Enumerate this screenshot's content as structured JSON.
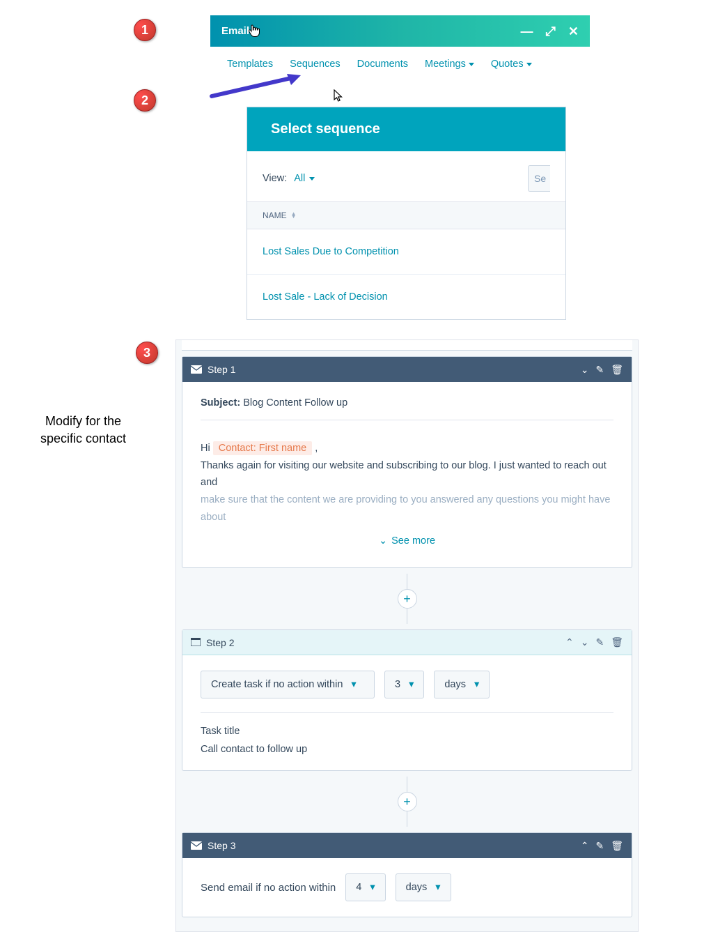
{
  "badges": {
    "b1": "1",
    "b2": "2",
    "b3": "3"
  },
  "emailBar": {
    "title": "Email"
  },
  "tabs": {
    "templates": "Templates",
    "sequences": "Sequences",
    "documents": "Documents",
    "meetings": "Meetings",
    "quotes": "Quotes"
  },
  "seqPanel": {
    "heading": "Select sequence",
    "viewLabel": "View:",
    "viewValue": "All",
    "searchPrefix": "Se",
    "col_name": "NAME",
    "rows": [
      "Lost Sales Due to Competition",
      "Lost Sale - Lack of Decision"
    ]
  },
  "annotation": "Modify for the\nspecific contact",
  "step1": {
    "label": "Step 1",
    "subjectLabel": "Subject:",
    "subjectValue": "Blog Content Follow up",
    "greeting": "Hi ",
    "token": "Contact: First name",
    "comma": " ,",
    "line1": "Thanks again for visiting our website and subscribing to our blog.  I just wanted to reach out and",
    "line2": "make sure that the content we are providing to you answered any questions you might have about",
    "seeMore": "See more"
  },
  "step2": {
    "label": "Step 2",
    "action": "Create task if no action within",
    "num": "3",
    "unit": "days",
    "taskTitleLabel": "Task title",
    "taskTitleValue": "Call contact to follow up"
  },
  "step3": {
    "label": "Step 3",
    "text": "Send email if no action within",
    "num": "4",
    "unit": "days"
  }
}
